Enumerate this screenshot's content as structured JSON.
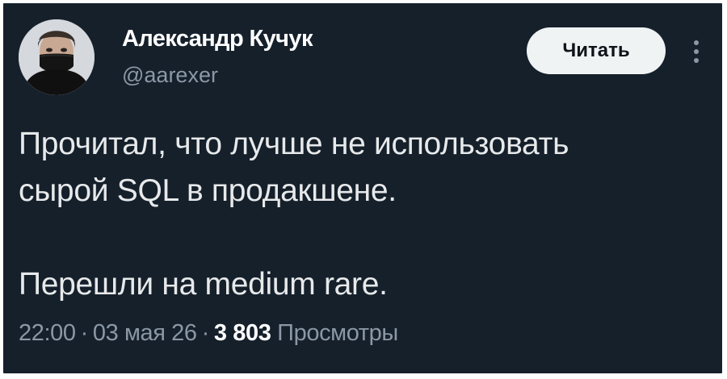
{
  "author": {
    "display_name": "Александр Кучук",
    "handle": "@aarexer",
    "avatar_icon": "profile-photo-masked-person"
  },
  "actions": {
    "follow_label": "Читать",
    "more_icon": "more-vertical-icon"
  },
  "tweet": {
    "paragraphs": [
      "Прочитал, что лучше не использовать\nсырой SQL в продакшене.",
      "Перешли на medium rare."
    ]
  },
  "meta": {
    "time": "22:00",
    "separator": "·",
    "date": "03 мая 26",
    "views_count": "3 803",
    "views_label": "Просмотры"
  },
  "colors": {
    "background": "#15202b",
    "primary_text": "#e7e9ea",
    "secondary_text": "#8b98a5",
    "button_bg": "#eff3f4"
  }
}
